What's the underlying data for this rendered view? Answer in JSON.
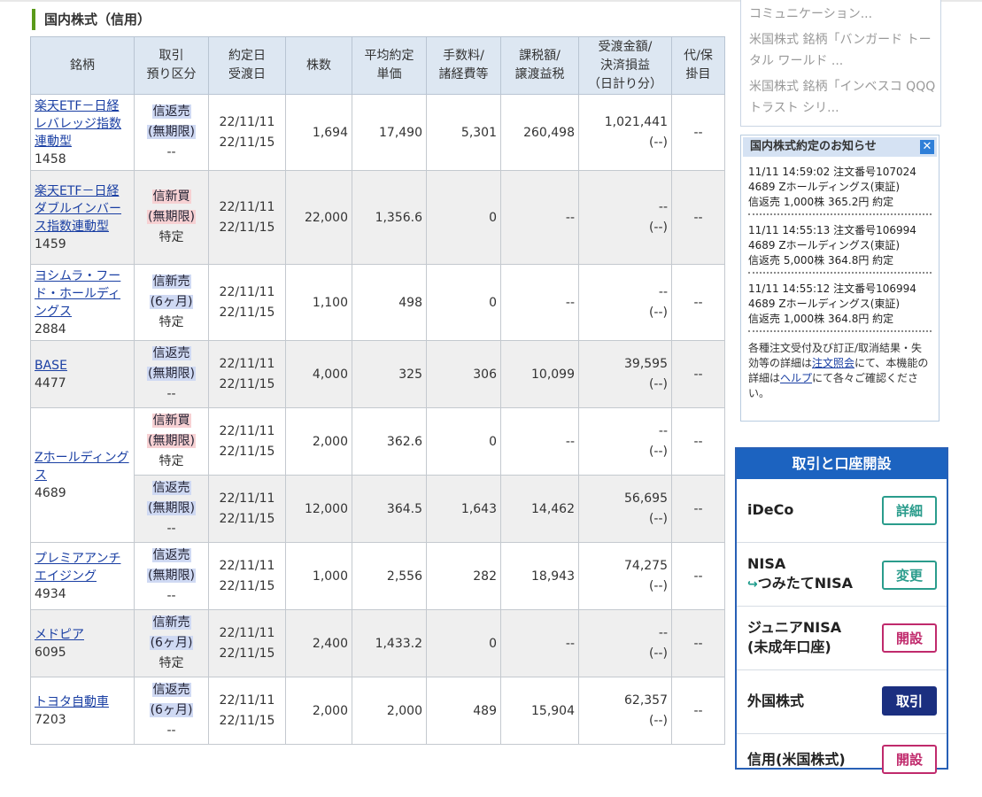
{
  "section": {
    "title": "国内株式（信用）"
  },
  "table": {
    "headers": [
      "銘柄",
      "取引\n預り区分",
      "約定日\n受渡日",
      "株数",
      "平均約定\n単価",
      "手数料/\n諸経費等",
      "課税額/\n譲渡益税",
      "受渡金額/\n決済損益\n（日計り分）",
      "代/保\n掛目"
    ],
    "rows": [
      {
        "name": "楽天ETF－日経レバレッジ指数連動型",
        "code": "1458",
        "type": "信返売",
        "custody": "(無期限)",
        "account": "--",
        "trade_date": "22/11/11",
        "settle_date": "22/11/15",
        "shares": "1,694",
        "price": "17,490",
        "fee": "5,301",
        "tax": "260,498",
        "amount": "1,021,441",
        "pnl": "(--)",
        "margin": "--"
      },
      {
        "name": "楽天ETF－日経ダブルインバース指数連動型",
        "code": "1459",
        "type": "信新買",
        "custody": "(無期限)",
        "account": "特定",
        "trade_date": "22/11/11",
        "settle_date": "22/11/15",
        "shares": "22,000",
        "price": "1,356.6",
        "fee": "0",
        "tax": "--",
        "amount": "--",
        "pnl": "(--)",
        "margin": "--"
      },
      {
        "name": "ヨシムラ・フード・ホールディングス",
        "code": "2884",
        "type": "信新売",
        "custody": "(6ヶ月)",
        "account": "特定",
        "trade_date": "22/11/11",
        "settle_date": "22/11/15",
        "shares": "1,100",
        "price": "498",
        "fee": "0",
        "tax": "--",
        "amount": "--",
        "pnl": "(--)",
        "margin": "--"
      },
      {
        "name": "BASE",
        "code": "4477",
        "type": "信返売",
        "custody": "(無期限)",
        "account": "--",
        "trade_date": "22/11/11",
        "settle_date": "22/11/15",
        "shares": "4,000",
        "price": "325",
        "fee": "306",
        "tax": "10,099",
        "amount": "39,595",
        "pnl": "(--)",
        "margin": "--"
      },
      {
        "name": "Zホールディングス",
        "code": "4689",
        "type": "信新買",
        "custody": "(無期限)",
        "account": "特定",
        "trade_date": "22/11/11",
        "settle_date": "22/11/15",
        "shares": "2,000",
        "price": "362.6",
        "fee": "0",
        "tax": "--",
        "amount": "--",
        "pnl": "(--)",
        "margin": "--"
      },
      {
        "type": "信返売",
        "custody": "(無期限)",
        "account": "--",
        "trade_date": "22/11/11",
        "settle_date": "22/11/15",
        "shares": "12,000",
        "price": "364.5",
        "fee": "1,643",
        "tax": "14,462",
        "amount": "56,695",
        "pnl": "(--)",
        "margin": "--"
      },
      {
        "name": "プレミアアンチエイジング",
        "code": "4934",
        "type": "信返売",
        "custody": "(無期限)",
        "account": "--",
        "trade_date": "22/11/11",
        "settle_date": "22/11/15",
        "shares": "1,000",
        "price": "2,556",
        "fee": "282",
        "tax": "18,943",
        "amount": "74,275",
        "pnl": "(--)",
        "margin": "--"
      },
      {
        "name": "メドピア",
        "code": "6095",
        "type": "信新売",
        "custody": "(6ヶ月)",
        "account": "特定",
        "trade_date": "22/11/11",
        "settle_date": "22/11/15",
        "shares": "2,400",
        "price": "1,433.2",
        "fee": "0",
        "tax": "--",
        "amount": "--",
        "pnl": "(--)",
        "margin": "--"
      },
      {
        "name": "トヨタ自動車",
        "code": "7203",
        "type": "信返売",
        "custody": "(6ヶ月)",
        "account": "--",
        "trade_date": "22/11/11",
        "settle_date": "22/11/15",
        "shares": "2,000",
        "price": "2,000",
        "fee": "489",
        "tax": "15,904",
        "amount": "62,357",
        "pnl": "(--)",
        "margin": "--"
      }
    ]
  },
  "news": [
    "コミュニケーション...",
    "米国株式 銘柄「バンガード トータル ワールド ...",
    "米国株式 銘柄「インベスコ QQQトラスト シリ..."
  ],
  "notice": {
    "title": "国内株式約定のお知らせ",
    "close_icon": "✕",
    "entries": [
      {
        "line1": "11/11 14:59:02 注文番号107024",
        "line2": "4689 Zホールディングス(東証)",
        "line3": "信返売 1,000株 365.2円 約定"
      },
      {
        "line1": "11/11 14:55:13 注文番号106994",
        "line2": "4689 Zホールディングス(東証)",
        "line3": "信返売 5,000株 364.8円 約定"
      },
      {
        "line1": "11/11 14:55:12 注文番号106994",
        "line2": "4689 Zホールディングス(東証)",
        "line3": "信返売 1,000株 364.8円 約定"
      }
    ],
    "footer_pre": "各種注文受付及び訂正/取消結果・失効等の詳細は",
    "footer_link1": "注文照会",
    "footer_mid": "にて、本機能の詳細は",
    "footer_link2": "ヘルプ",
    "footer_post": "にて各々ご確認ください。"
  },
  "panel": {
    "title": "取引と口座開設",
    "rows": [
      {
        "label": "iDeCo",
        "button": "詳細"
      },
      {
        "label": "NISA",
        "sub_arrow": "↪",
        "sub": "つみたてNISA",
        "button": "変更"
      },
      {
        "label": "ジュニアNISA",
        "sub": "(未成年口座)",
        "button": "開設"
      },
      {
        "label": "外国株式",
        "button": "取引"
      },
      {
        "label": "信用(米国株式)",
        "button": "開設"
      }
    ]
  }
}
